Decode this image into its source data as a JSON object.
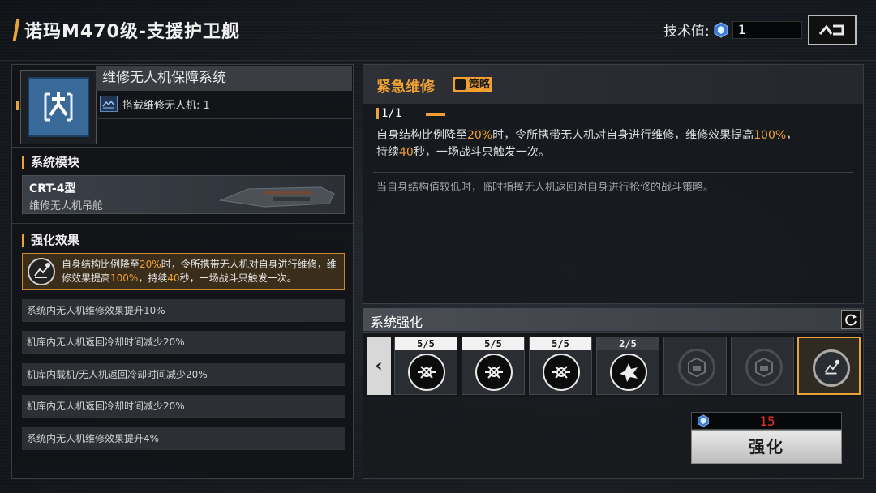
{
  "header": {
    "title": "诺玛M470级-支援护卫舰",
    "tech_label": "技术值:",
    "tech_value": "1",
    "back_icon": "back-icon"
  },
  "system": {
    "name": "维修无人机保障系统",
    "sub_label": "搭载维修无人机: 1",
    "icon": "drone-repair-icon",
    "accent_color": "#3a6a9a"
  },
  "module_section": {
    "title": "系统模块",
    "name": "CRT-4型",
    "subtitle": "维修无人机吊舱"
  },
  "enhance_effect": {
    "title": "强化效果",
    "main_text": "自身结构比例降至20%时，令所携带无人机对自身进行维修，维修效果提高100%，持续40秒，一场战斗只触发一次。",
    "stats": [
      "系统内无人机维修效果提升10%",
      "机库内无人机返回冷却时间减少20%",
      "机库内载机/无人机返回冷却时间减少20%",
      "机库内无人机返回冷却时间减少20%",
      "系统内无人机维修效果提升4%"
    ]
  },
  "skill": {
    "name": "紧急维修",
    "tag": "策略",
    "count": "1/1",
    "desc_line1": "自身结构比例降至20%时，令所携带无人机对自身进行维修，维修效果提高100%，",
    "desc_line2": "持续40秒，一场战斗只触发一次。",
    "flavor": "当自身结构值较低时，临时指挥无人机返回对自身进行抢修的战斗策略。"
  },
  "enhance": {
    "title": "系统强化",
    "slots": [
      {
        "count": "5/5",
        "icon": "drone-return-icon"
      },
      {
        "count": "5/5",
        "icon": "drone-return-icon"
      },
      {
        "count": "5/5",
        "icon": "drone-return-icon"
      },
      {
        "count": "2/5",
        "icon": "burst-icon"
      },
      {
        "count": "",
        "icon": "locked-hex-icon"
      },
      {
        "count": "",
        "icon": "locked-hex-icon"
      },
      {
        "count": "",
        "icon": "strategy-repair-icon"
      }
    ],
    "cost": "15",
    "button_label": "强化",
    "highlight_color": "#f0a030",
    "cost_color": "#e8302a"
  }
}
